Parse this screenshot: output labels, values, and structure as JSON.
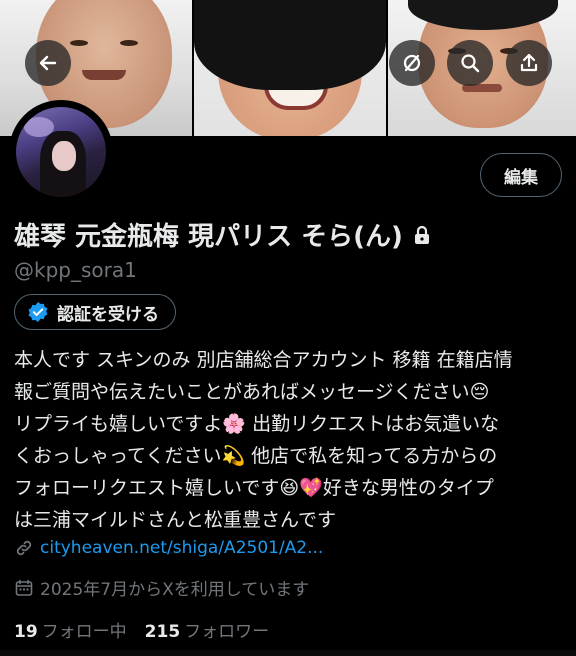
{
  "header": {
    "back_icon": "arrow-left-icon",
    "mute_icon": "circle-slash-icon",
    "search_icon": "search-icon",
    "share_icon": "share-upload-icon"
  },
  "profile": {
    "edit_label": "編集",
    "name": "雄琴 元金瓶梅 現パリス そら(ん)",
    "handle": "@kpp_sora1",
    "verify_label": "認証を受ける",
    "bio_lines": [
      "本人です スキンのみ 別店舗総合アカウント 移籍 在籍店情",
      "報ご質問や伝えたいことがあればメッセージください😔",
      "リプライも嬉しいですよ🌸 出勤リクエストはお気遣いな",
      "くおっしゃってください💫 他店で私を知ってる方からの",
      "フォローリクエスト嬉しいです😆💖好きな男性のタイプ",
      "は三浦マイルドさんと松重豊さんです"
    ],
    "link": "cityheaven.net/shiga/A2501/A2...",
    "joined": "2025年7月からXを利用しています",
    "following_count": "19",
    "following_label": "フォロー中",
    "followers_count": "215",
    "followers_label": "フォロワー"
  },
  "colors": {
    "background": "#000000",
    "text": "#e7e9ea",
    "muted": "#71767b",
    "link": "#1d9bf0",
    "border": "#536471"
  }
}
